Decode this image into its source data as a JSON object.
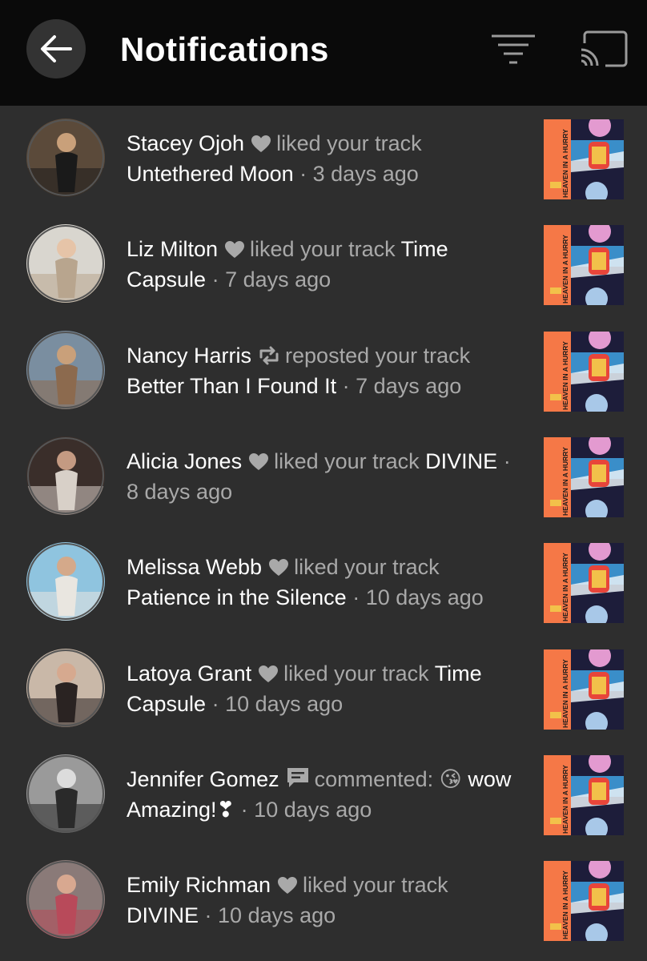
{
  "header": {
    "title": "Notifications",
    "back_icon": "arrow-left-icon",
    "filter_icon": "filter-icon",
    "cast_icon": "cast-icon",
    "background": "#0a0a0a"
  },
  "artwork": {
    "label": "HEAVEN IN A HURRY",
    "colors": [
      "#f57847",
      "#e8453a",
      "#3a8ec9",
      "#1d1d3a"
    ]
  },
  "notifications": [
    {
      "name": "Stacey Ojoh",
      "icon": "heart-icon",
      "action": "liked your track",
      "track": "Untethered Moon",
      "time": "3 days ago"
    },
    {
      "name": "Liz Milton",
      "icon": "heart-icon",
      "action": "liked your track",
      "track": "Time Capsule",
      "time": "7 days ago"
    },
    {
      "name": "Nancy Harris",
      "icon": "repost-icon",
      "action": "reposted your track",
      "track": "Better Than I Found It",
      "time": "7 days ago"
    },
    {
      "name": "Alicia Jones",
      "icon": "heart-icon",
      "action": "liked your track",
      "track": "DIVINE",
      "time": "8 days ago"
    },
    {
      "name": "Melissa Webb",
      "icon": "heart-icon",
      "action": "liked your track",
      "track": "Patience in the Silence",
      "time": "10 days ago"
    },
    {
      "name": "Latoya Grant",
      "icon": "heart-icon",
      "action": "liked your track",
      "track": "Time Capsule",
      "time": "10 days ago"
    },
    {
      "name": "Jennifer Gomez",
      "icon": "comment-icon",
      "action": "commented: 😘",
      "track": "wow Amazing!❣",
      "time": "10 days ago"
    },
    {
      "name": "Emily Richman",
      "icon": "heart-icon",
      "action": "liked your track",
      "track": "DIVINE",
      "time": "10 days ago"
    }
  ]
}
